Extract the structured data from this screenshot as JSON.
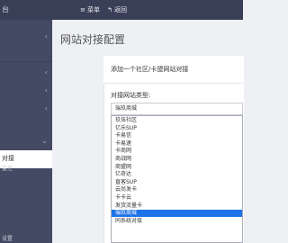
{
  "topbar": {
    "brand": "台",
    "menu_label": "菜单",
    "back_label": "返回"
  },
  "sidebar": {
    "items": [
      {
        "label": "",
        "arrow": "‹"
      },
      {
        "label": "",
        "arrow": "‹"
      },
      {
        "label": "",
        "arrow": "‹"
      },
      {
        "label": "",
        "arrow": "‹"
      },
      {
        "label": "",
        "arrow": "⌄"
      }
    ],
    "active_item": "对接",
    "lower_items": [
      "监控",
      "设置"
    ]
  },
  "page": {
    "title": "网站对接配置"
  },
  "panel": {
    "heading": "添加一个社区/卡盟网站对接",
    "field_label": "对接网站类型:",
    "selected_value": "瑞玖商城",
    "options": [
      "玖伍社区",
      "亿乐SUP",
      "卡易信",
      "卡易速",
      "卡商网",
      "商战网",
      "商盟网",
      "亿奇达",
      "直客SUP",
      "云尚发卡",
      "卡卡云",
      "发货流量卡",
      "瑞玖商城",
      "同系统对接"
    ],
    "selected_index": 12
  },
  "colors": {
    "topbar": "#3a3f58",
    "sidebar": "#444a63",
    "highlight": "#1e73e8"
  }
}
